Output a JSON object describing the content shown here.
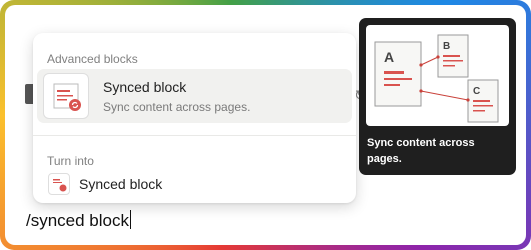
{
  "menu": {
    "section_advanced": "Advanced blocks",
    "item": {
      "title": "Synced block",
      "description": "Sync content across pages."
    },
    "section_turn_into": "Turn into",
    "turn_into_item": {
      "label": "Synced block"
    }
  },
  "preview": {
    "caption": "Sync content across pages.",
    "labels": {
      "a": "A",
      "b": "B",
      "c": "C"
    }
  },
  "editor": {
    "typed_text": "/synced block"
  },
  "colors": {
    "accent_red": "#d9534f",
    "preview_bg": "#1f1f1f",
    "selected_bg": "#f1f1ef"
  },
  "icons": [
    "synced-block-icon",
    "sync-arrows-icon"
  ]
}
